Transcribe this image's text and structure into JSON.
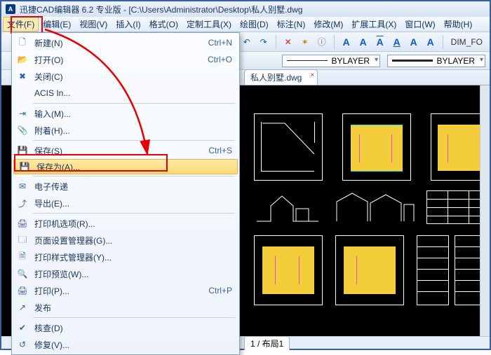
{
  "title": {
    "app": "迅捷CAD编辑器 6.2 专业版  -  [C:\\Users\\Administrator\\Desktop\\私人别墅.dwg",
    "icon": "A"
  },
  "menu": {
    "items": [
      "文件(F)",
      "编辑(E)",
      "视图(V)",
      "插入(I)",
      "格式(O)",
      "定制工具(X)",
      "绘图(D)",
      "标注(N)",
      "修改(M)",
      "扩展工具(X)",
      "窗口(W)",
      "帮助(H)"
    ],
    "highlighted_index": 0
  },
  "toolbar": {
    "right_icons": [
      "↶",
      "↷",
      "|",
      "✕",
      "✶",
      "ℹ",
      "|"
    ],
    "a_buttons": [
      "A",
      "A",
      "A",
      "A",
      "A",
      "A"
    ],
    "dim_label": "DIM_FO"
  },
  "linetype": {
    "label1": "BYLAYER",
    "label2": "BYLAYER"
  },
  "doc_tab": {
    "label": "私人别墅.dwg",
    "close": "×"
  },
  "bottom_tabs": {
    "t": "1 / 布局1"
  },
  "file_menu": {
    "rows": [
      {
        "ic": "🗋",
        "lbl": "新建(N)",
        "sh": "Ctrl+N"
      },
      {
        "ic": "📂",
        "lbl": "打开(O)",
        "sh": "Ctrl+O"
      },
      {
        "ic": "✖",
        "lbl": "关闭(C)",
        "sh": ""
      },
      {
        "ic": "",
        "lbl": "ACIS In...",
        "sh": ""
      },
      {
        "sep": true
      },
      {
        "ic": "⇥",
        "lbl": "输入(M)...",
        "sh": ""
      },
      {
        "ic": "📎",
        "lbl": "附着(H)...",
        "sh": ""
      },
      {
        "sep": true
      },
      {
        "ic": "💾",
        "lbl": "保存(S)",
        "sh": "Ctrl+S"
      },
      {
        "ic": "💾",
        "lbl": "保存为(A)...",
        "sh": "",
        "hover": true
      },
      {
        "sep": true
      },
      {
        "ic": "✉",
        "lbl": "电子传递",
        "sh": ""
      },
      {
        "ic": "⤴",
        "lbl": "导出(E)...",
        "sh": ""
      },
      {
        "sep": true
      },
      {
        "ic": "🖨",
        "lbl": "打印机选项(R)...",
        "sh": ""
      },
      {
        "ic": "🗔",
        "lbl": "页面设置管理器(G)...",
        "sh": ""
      },
      {
        "ic": "🗎",
        "lbl": "打印样式管理器(Y)...",
        "sh": ""
      },
      {
        "ic": "🔍",
        "lbl": "打印预览(W)...",
        "sh": ""
      },
      {
        "ic": "🖨",
        "lbl": "打印(P)...",
        "sh": "Ctrl+P"
      },
      {
        "ic": "↗",
        "lbl": "发布",
        "sh": ""
      },
      {
        "sep": true
      },
      {
        "ic": "✔",
        "lbl": "核查(D)",
        "sh": ""
      },
      {
        "ic": "↺",
        "lbl": "修复(V)...",
        "sh": ""
      }
    ]
  }
}
